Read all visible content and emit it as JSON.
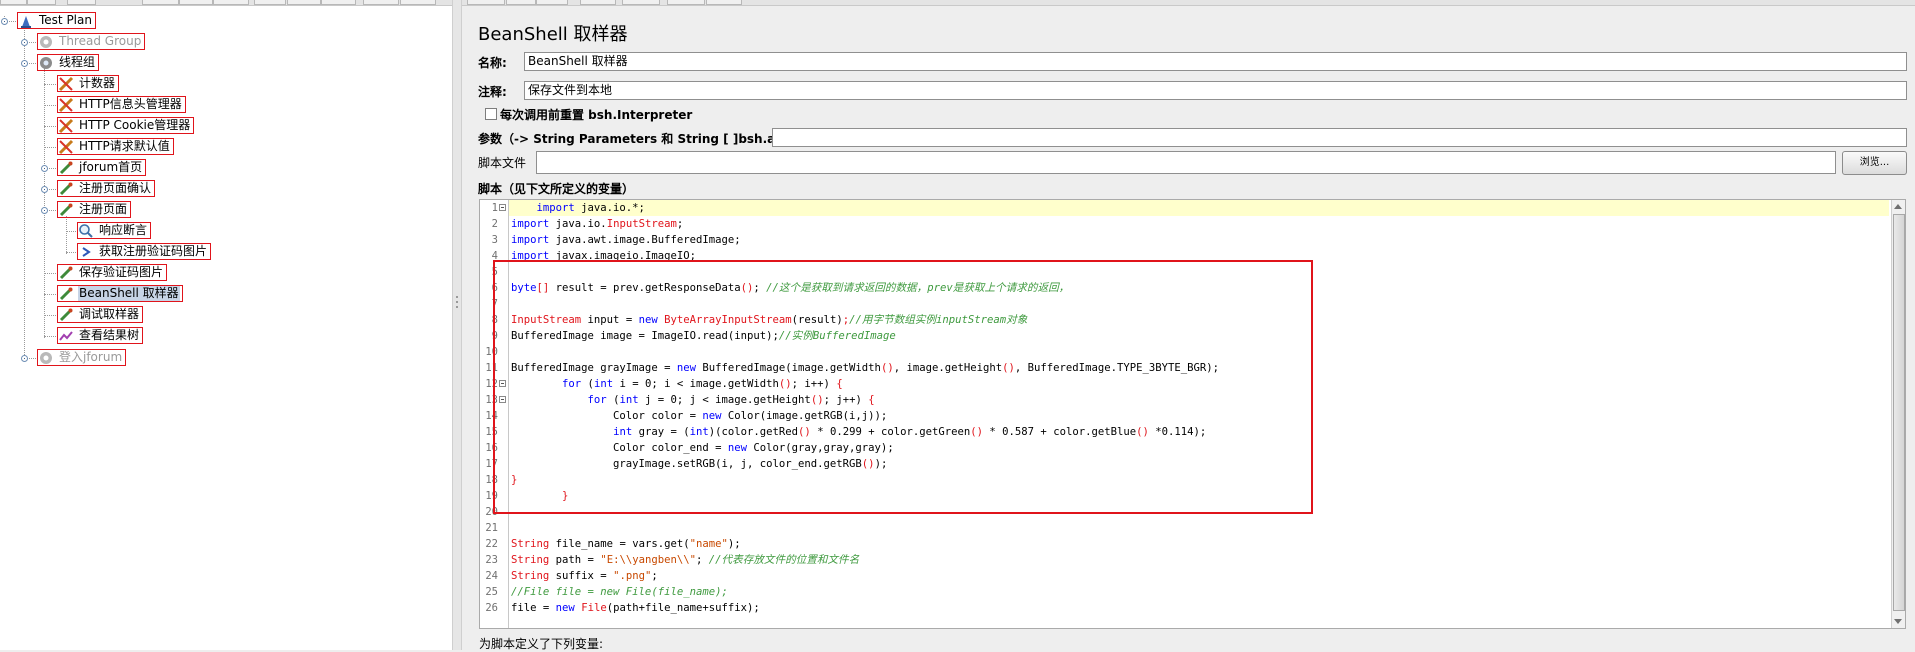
{
  "tree": {
    "nodes": [
      {
        "label": "Test Plan",
        "icon": "test-plan-icon",
        "disabled": false
      },
      {
        "label": "Thread Group",
        "icon": "gear-icon",
        "disabled": true
      },
      {
        "label": "线程组",
        "icon": "gear-icon",
        "disabled": false
      },
      {
        "label": "计数器",
        "icon": "config-element-icon",
        "disabled": false
      },
      {
        "label": "HTTP信息头管理器",
        "icon": "config-element-icon",
        "disabled": false
      },
      {
        "label": "HTTP Cookie管理器",
        "icon": "config-element-icon",
        "disabled": false
      },
      {
        "label": "HTTP请求默认值",
        "icon": "config-element-icon",
        "disabled": false
      },
      {
        "label": "jforum首页",
        "icon": "sampler-icon",
        "disabled": false
      },
      {
        "label": "注册页面确认",
        "icon": "sampler-icon",
        "disabled": false
      },
      {
        "label": "注册页面",
        "icon": "sampler-icon",
        "disabled": false
      },
      {
        "label": "响应断言",
        "icon": "magnifier-icon",
        "disabled": false
      },
      {
        "label": "获取注册验证码图片",
        "icon": "post-processor-icon",
        "disabled": false
      },
      {
        "label": "保存验证码图片",
        "icon": "sampler-icon",
        "disabled": false
      },
      {
        "label": "BeanShell 取样器",
        "icon": "sampler-icon",
        "disabled": false,
        "selected": true
      },
      {
        "label": "调试取样器",
        "icon": "sampler-icon",
        "disabled": false
      },
      {
        "label": "查看结果树",
        "icon": "listener-icon",
        "disabled": false
      },
      {
        "label": "登入jforum",
        "icon": "gear-icon",
        "disabled": true
      }
    ]
  },
  "panel": {
    "title": "BeanShell 取样器",
    "name_label": "名称:",
    "name_value": "BeanShell 取样器",
    "comment_label": "注释:",
    "comment_value": "保存文件到本地",
    "reset_checkbox_label": "每次调用前重置 bsh.Interpreter",
    "params_label": "参数（-> String Parameters 和 String [ ]bsh.args）",
    "params_value": "",
    "script_file_label": "脚本文件",
    "script_file_value": "",
    "browse_label": "浏览...",
    "script_label": "脚本（见下文所定义的变量）",
    "vars_label": "为脚本定义了下列变量:"
  },
  "editor": {
    "line_numbers": [
      "1",
      "2",
      "3",
      "4",
      "5",
      "6",
      "7",
      "8",
      "9",
      "10",
      "11",
      "12",
      "13",
      "14",
      "15",
      "16",
      "17",
      "18",
      "19",
      "20",
      "21",
      "22",
      "23",
      "24",
      "25",
      "26"
    ],
    "fold_lines": [
      1,
      12,
      13
    ]
  },
  "colors": {
    "annotation_red": "#e0141b",
    "keyword_blue": "#0000ff",
    "comment_green": "#3f9a3f",
    "string_orange": "#c84900",
    "current_line": "#ffffcc",
    "selection": "#c7d4e6"
  }
}
